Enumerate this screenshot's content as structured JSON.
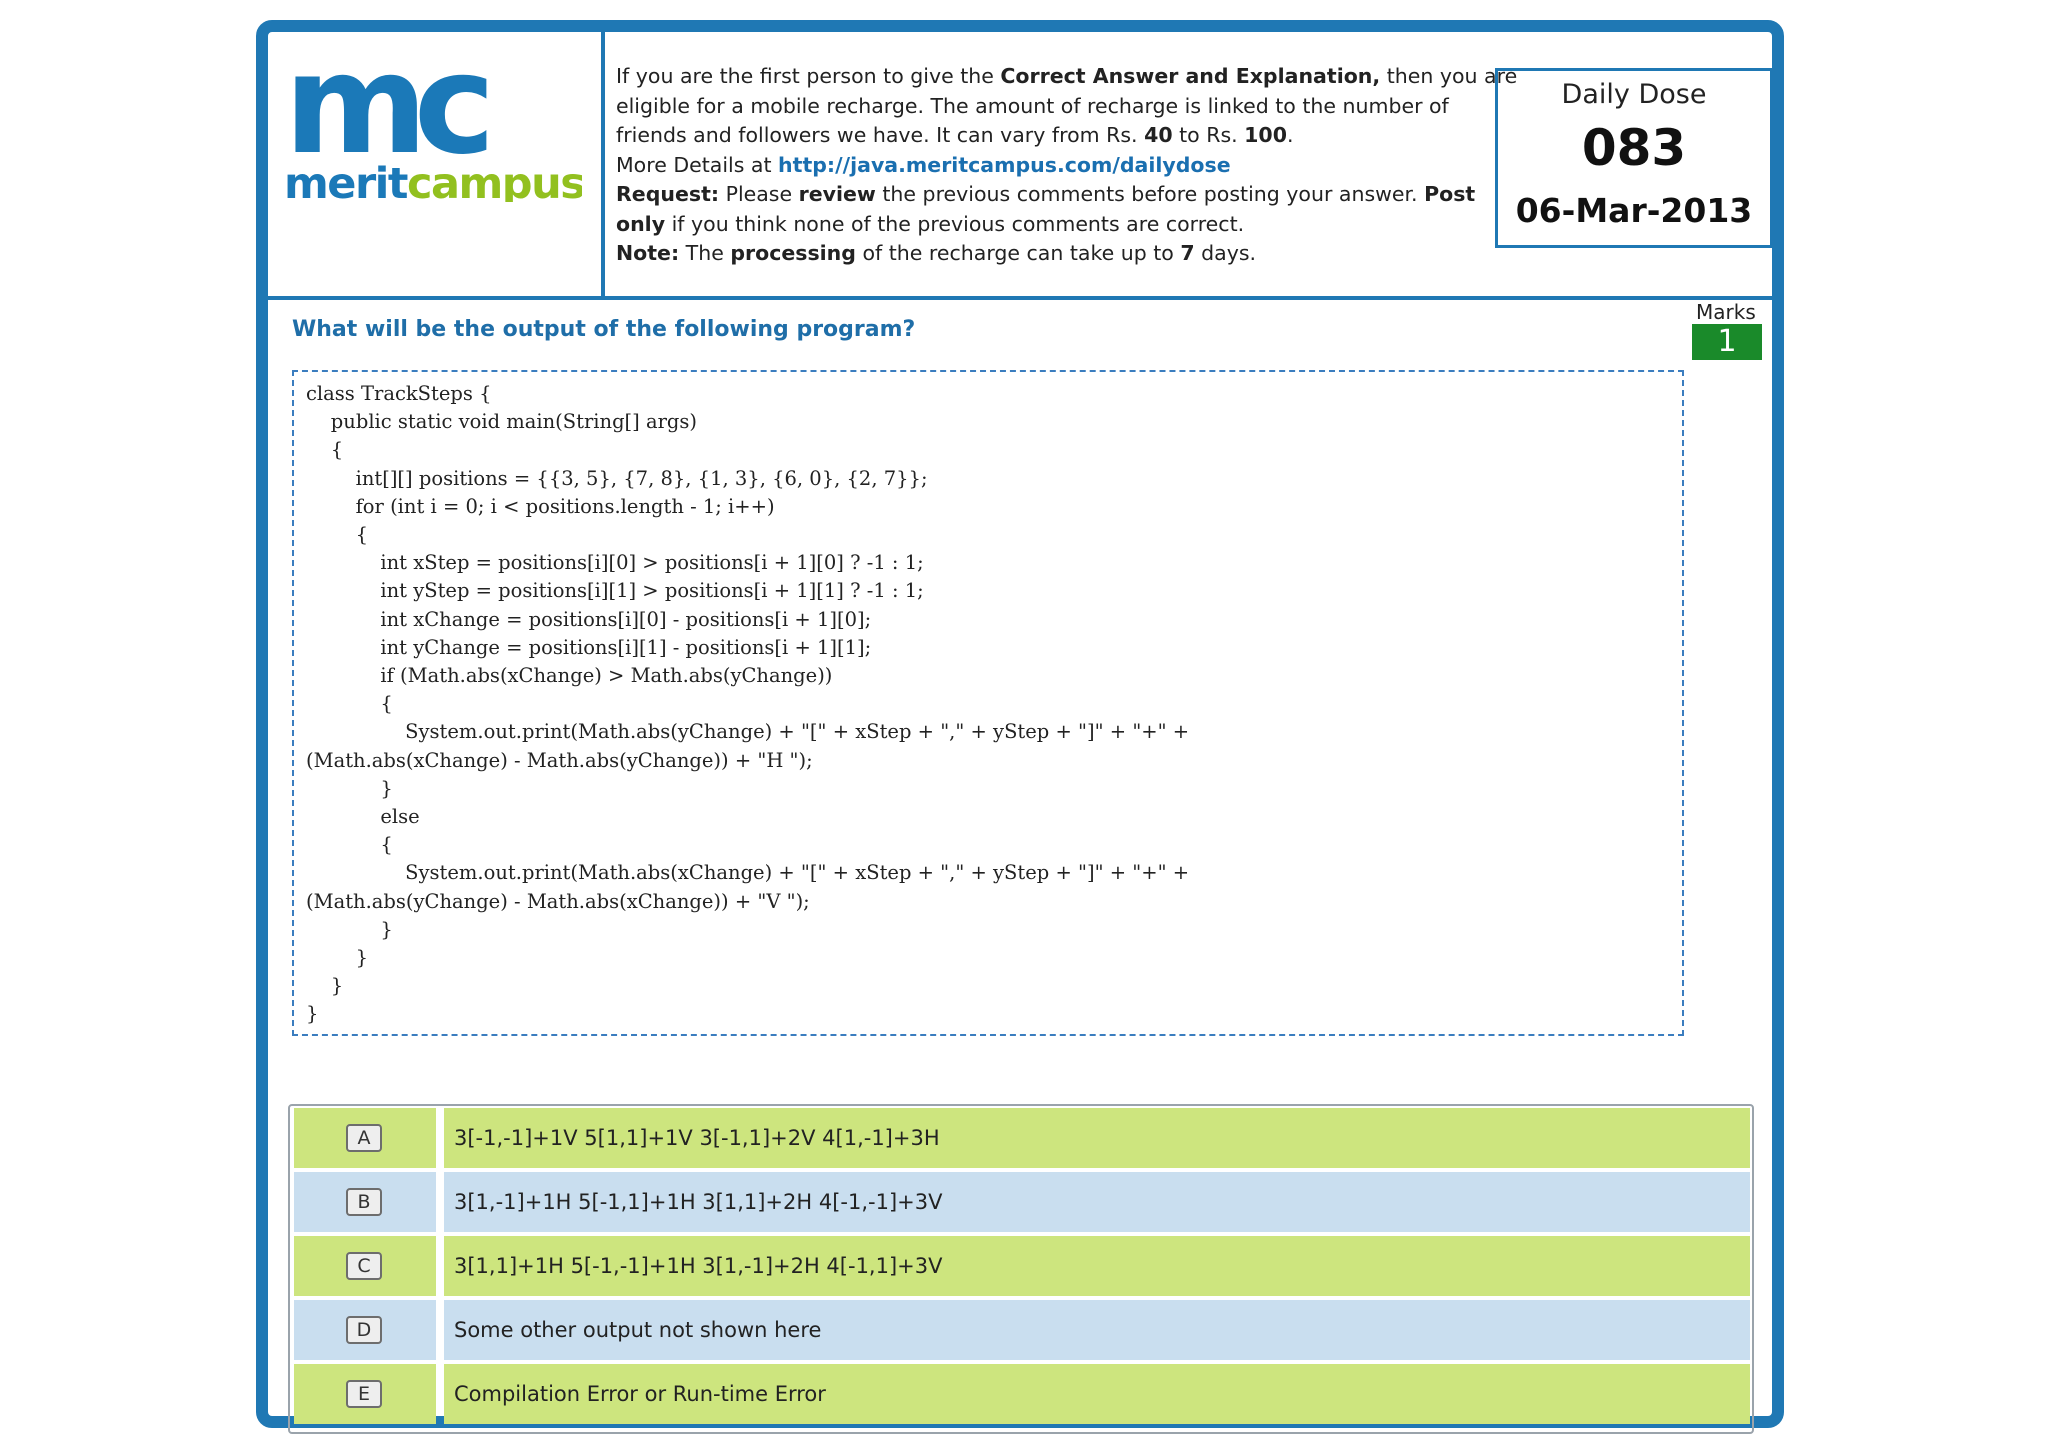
{
  "logo": {
    "mark": "mc",
    "wordmark_part1": "merit",
    "wordmark_part2": "campus",
    "colors": {
      "blue": "#1b79b8",
      "green": "#92c01f"
    }
  },
  "info": {
    "line1_a": "If you are the first person to give the ",
    "line1_b": "Correct Answer and Explanation,",
    "line1_c": " then you are",
    "line2": "eligible for a  mobile recharge. The amount of recharge is linked to the number of",
    "line3_a": "friends and followers we have. It can vary from Rs. ",
    "line3_b": "40",
    "line3_c": "  to Rs. ",
    "line3_d": "100",
    "line3_e": ".",
    "line4_a": "More Details at ",
    "line4_link": "http://java.meritcampus.com/dailydose",
    "line5_a": "Request:",
    "line5_b": "  Please ",
    "line5_c": "review",
    "line5_d": " the previous comments before posting your answer.  ",
    "line5_e": "Post",
    "line6_a": "only",
    "line6_b": " if you think none of the previous comments are correct.",
    "line7_a": "Note:",
    "line7_b": " The ",
    "line7_c": "processing",
    "line7_d": " of the recharge can take up to ",
    "line7_e": "7",
    "line7_f": " days."
  },
  "daily_dose": {
    "title": "Daily Dose",
    "number": "083",
    "date": "06-Mar-2013"
  },
  "question": {
    "text": "What will be the output of the following program?",
    "marks_label": "Marks",
    "marks_value": "1"
  },
  "code": "class TrackSteps {\n    public static void main(String[] args)\n    {\n        int[][] positions = {{3, 5}, {7, 8}, {1, 3}, {6, 0}, {2, 7}};\n        for (int i = 0; i < positions.length - 1; i++)\n        {\n            int xStep = positions[i][0] > positions[i + 1][0] ? -1 : 1;\n            int yStep = positions[i][1] > positions[i + 1][1] ? -1 : 1;\n            int xChange = positions[i][0] - positions[i + 1][0];\n            int yChange = positions[i][1] - positions[i + 1][1];\n            if (Math.abs(xChange) > Math.abs(yChange))\n            {\n                System.out.print(Math.abs(yChange) + \"[\" + xStep + \",\" + yStep + \"]\" + \"+\" +\n(Math.abs(xChange) - Math.abs(yChange)) + \"H \");\n            }\n            else\n            {\n                System.out.print(Math.abs(xChange) + \"[\" + xStep + \",\" + yStep + \"]\" + \"+\" +\n(Math.abs(yChange) - Math.abs(xChange)) + \"V \");\n            }\n        }\n    }\n}",
  "options": [
    {
      "letter": "A",
      "text": "3[-1,-1]+1V 5[1,1]+1V 3[-1,1]+2V 4[1,-1]+3H"
    },
    {
      "letter": "B",
      "text": "3[1,-1]+1H 5[-1,1]+1H 3[1,1]+2H 4[-1,-1]+3V"
    },
    {
      "letter": "C",
      "text": "3[1,1]+1H 5[-1,-1]+1H 3[1,-1]+2H 4[-1,1]+3V"
    },
    {
      "letter": "D",
      "text": "Some other output not shown here"
    },
    {
      "letter": "E",
      "text": "Compilation Error or Run-time Error"
    }
  ],
  "colors": {
    "frame": "#1f78b4",
    "option_green": "#cde57e",
    "option_blue": "#c9deef",
    "marks_badge": "#1a8a2a",
    "question_text": "#1f6ea8"
  }
}
